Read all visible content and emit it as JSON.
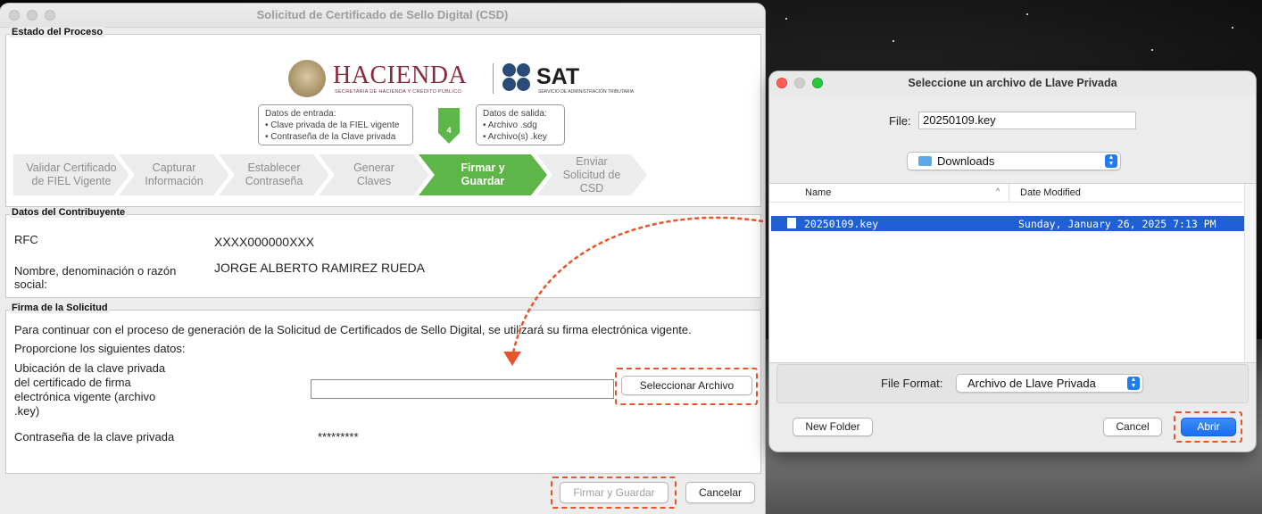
{
  "main_window": {
    "title": "Solicitud de Certificado de Sello Digital (CSD)",
    "estado": {
      "group_label": "Estado del Proceso",
      "logo": {
        "hacienda_word": "HACIENDA",
        "hacienda_sub": "SECRETARÍA DE HACIENDA Y CRÉDITO PÚBLICO",
        "sat_word": "SAT",
        "sat_sub": "SERVICIO DE ADMINISTRACIÓN TRIBUTARIA"
      },
      "entrada": {
        "title": "Datos de entrada:",
        "items": [
          "• Clave privada de la FIEL vigente",
          "• Contraseña de la Clave privada"
        ]
      },
      "step_number": "4",
      "salida": {
        "title": "Datos de salida:",
        "items": [
          "• Archivo .sdg",
          "• Archivo(s) .key"
        ]
      },
      "steps": [
        {
          "line1": "Validar Certificado",
          "line2": "de FIEL Vigente",
          "line3": ""
        },
        {
          "line1": "Capturar",
          "line2": "Información",
          "line3": ""
        },
        {
          "line1": "Establecer",
          "line2": "Contraseña",
          "line3": ""
        },
        {
          "line1": "Generar",
          "line2": "Claves",
          "line3": ""
        },
        {
          "line1": "Firmar y",
          "line2": "Guardar",
          "line3": ""
        },
        {
          "line1": "Enviar",
          "line2": "Solicitud de",
          "line3": "CSD"
        }
      ],
      "active_step": 5
    },
    "contribuyente": {
      "group_label": "Datos del Contribuyente",
      "rfc_label": "RFC",
      "rfc_value": "XXXX000000XXX",
      "nombre_label_1": "Nombre, denominación o razón",
      "nombre_label_2": "social:",
      "nombre_value": "JORGE ALBERTO RAMIREZ RUEDA"
    },
    "firma": {
      "group_label": "Firma de la Solicitud",
      "intro": "Para continuar con el proceso de generación de la Solicitud de Certificados de Sello Digital, se utilizará su firma electrónica vigente.",
      "proporcione": "Proporcione los siguientes datos:",
      "ubicacion_lines": [
        "Ubicación de la clave privada",
        "del certificado de firma",
        "electrónica vigente (archivo",
        ".key)"
      ],
      "path_value": "",
      "seleccionar_label": "Seleccionar Archivo",
      "password_label": "Contraseña de la clave privada",
      "password_value": "*********"
    },
    "footer": {
      "firmar_label": "Firmar y Guardar",
      "cancelar_label": "Cancelar"
    }
  },
  "dialog": {
    "title": "Seleccione un archivo de Llave Privada",
    "file_label": "File:",
    "file_value": "20250109.key",
    "location": "Downloads",
    "columns": {
      "name": "Name",
      "date": "Date Modified"
    },
    "files": [
      {
        "name": "20250109.key",
        "date": "Sunday, January 26, 2025 7:13 PM",
        "selected": true
      }
    ],
    "format_label": "File Format:",
    "format_value": "Archivo de Llave Privada",
    "new_folder_label": "New Folder",
    "cancel_label": "Cancel",
    "open_label": "Abrir"
  },
  "colors": {
    "accent_green": "#5eb548",
    "highlight_red": "#e8542c",
    "selection_blue": "#1f5fd8",
    "hacienda_wine": "#8b2a3f"
  }
}
